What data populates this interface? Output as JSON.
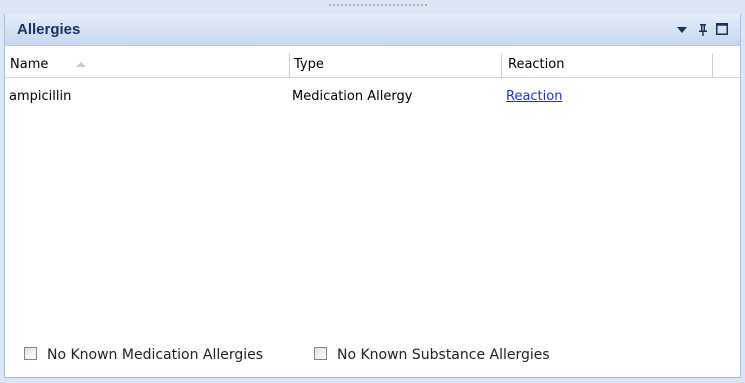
{
  "panel": {
    "title": "Allergies",
    "menu_icon": "dropdown-arrow-icon",
    "pin_icon": "pin-icon",
    "maximize_icon": "maximize-icon"
  },
  "grid": {
    "columns": [
      {
        "label": "Name",
        "sort": "ascending"
      },
      {
        "label": "Type"
      },
      {
        "label": "Reaction"
      }
    ],
    "rows": [
      {
        "name": "ampicillin",
        "type": "Medication Allergy",
        "reaction": "Reaction"
      }
    ]
  },
  "checkboxes": {
    "no_known_medication": {
      "label": "No Known Medication Allergies",
      "checked": false
    },
    "no_known_substance": {
      "label": "No Known Substance Allergies",
      "checked": false
    }
  },
  "colors": {
    "title_text": "#16325e",
    "link": "#1a35d6",
    "panel_border": "#a9bfdf"
  }
}
